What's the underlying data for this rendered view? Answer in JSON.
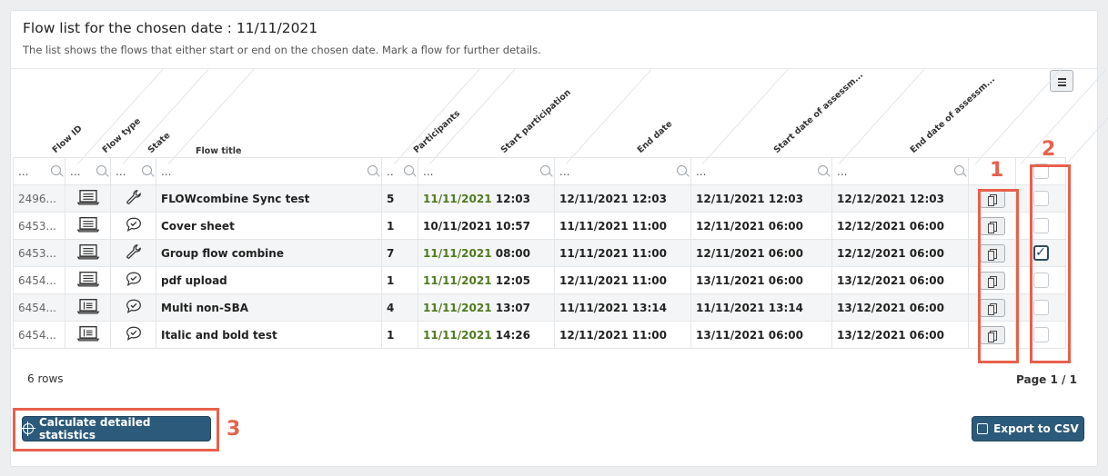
{
  "header": {
    "title": "Flow list for the chosen date : 11/11/2021",
    "subtitle": "The list shows the flows that either start or end on the chosen date. Mark a flow for further details."
  },
  "columns": [
    "Flow ID",
    "Flow type",
    "State",
    "Flow title",
    "Participants",
    "Start participation",
    "End date",
    "Start date of assessm...",
    "End date of assessm..."
  ],
  "filter_placeholder": "...",
  "filter_short": "..",
  "rows": [
    {
      "id": "2496...",
      "type_icon": "monitor-icon",
      "state_icon": "wrench-icon",
      "title": "FLOWcombine Sync test",
      "participants": "5",
      "start_date": "11/11/2021",
      "start_time": "12:03",
      "start_highlight": true,
      "end_date": "12/11/2021 12:03",
      "assess_start": "12/11/2021 12:03",
      "assess_end": "12/12/2021 12:03",
      "checked": false
    },
    {
      "id": "6453...",
      "type_icon": "monitor-icon",
      "state_icon": "chat-check-icon",
      "title": "Cover sheet",
      "participants": "1",
      "start_date": "10/11/2021",
      "start_time": "10:57",
      "start_highlight": false,
      "end_date": "11/11/2021 11:00",
      "assess_start": "12/11/2021 06:00",
      "assess_end": "12/12/2021 06:00",
      "checked": false
    },
    {
      "id": "6453...",
      "type_icon": "monitor-icon",
      "state_icon": "wrench-icon",
      "title": "Group flow combine",
      "participants": "7",
      "start_date": "11/11/2021",
      "start_time": "08:00",
      "start_highlight": true,
      "end_date": "11/11/2021 11:00",
      "assess_start": "12/11/2021 06:00",
      "assess_end": "12/12/2021 06:00",
      "checked": true
    },
    {
      "id": "6454...",
      "type_icon": "monitor-icon",
      "state_icon": "chat-check-icon",
      "title": "pdf upload",
      "participants": "1",
      "start_date": "11/11/2021",
      "start_time": "12:05",
      "start_highlight": true,
      "end_date": "12/11/2021 11:00",
      "assess_start": "13/11/2021 06:00",
      "assess_end": "13/12/2021 06:00",
      "checked": false
    },
    {
      "id": "6454...",
      "type_icon": "list-monitor-icon",
      "state_icon": "chat-check-icon",
      "title": "Multi non-SBA",
      "participants": "4",
      "start_date": "11/11/2021",
      "start_time": "13:07",
      "start_highlight": true,
      "end_date": "11/11/2021 13:14",
      "assess_start": "11/11/2021 13:14",
      "assess_end": "13/12/2021 06:00",
      "checked": false
    },
    {
      "id": "6454...",
      "type_icon": "list-monitor-icon",
      "state_icon": "chat-check-icon",
      "title": "Italic and bold test",
      "participants": "1",
      "start_date": "11/11/2021",
      "start_time": "14:26",
      "start_highlight": true,
      "end_date": "12/11/2021 11:00",
      "assess_start": "13/11/2021 06:00",
      "assess_end": "13/12/2021 06:00",
      "checked": false
    }
  ],
  "footer": {
    "rows_count": "6 rows",
    "page_indicator": "Page 1 / 1"
  },
  "buttons": {
    "calculate": "Calculate detailed statistics",
    "export": "Export to CSV"
  },
  "annotations": [
    "1",
    "2",
    "3"
  ],
  "colors": {
    "primary_button": "#2c5a7a",
    "highlight_date": "#4f7a1f",
    "annotation": "#e8604c",
    "checkbox_checked": "#2a4c63"
  }
}
